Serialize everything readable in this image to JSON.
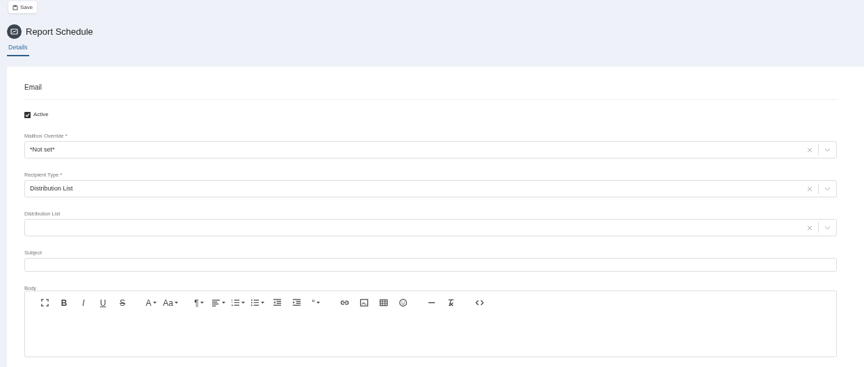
{
  "toolbar": {
    "save_button": "Save"
  },
  "header": {
    "title": "Report Schedule"
  },
  "tabs": [
    {
      "label": "Details",
      "selected": true
    }
  ],
  "form": {
    "section_title": "Email",
    "active": {
      "label": "Active",
      "checked": true
    },
    "fields": [
      {
        "kind": "select",
        "label": "Mailbox Override *",
        "value": "*Not set*"
      },
      {
        "kind": "select",
        "label": "Recipient Type *",
        "value": "Distribution List"
      },
      {
        "kind": "select",
        "label": "Distribution List"
      },
      {
        "kind": "text",
        "label": "Subject"
      },
      {
        "kind": "editor",
        "label": "Body"
      }
    ],
    "editor_toolbar": [
      [
        {
          "kind": "fullscreen"
        },
        {
          "kind": "bold",
          "glyph": "B"
        },
        {
          "kind": "italic",
          "glyph": "I"
        },
        {
          "kind": "underline",
          "glyph": "U"
        },
        {
          "kind": "strike",
          "glyph": "S"
        }
      ],
      [
        {
          "kind": "glyph",
          "glyph": "A",
          "caret": true
        },
        {
          "kind": "glyph",
          "glyph": "Aa",
          "caret": true
        }
      ],
      [
        {
          "kind": "glyph",
          "glyph": "¶",
          "caret": true
        },
        {
          "kind": "align",
          "caret": true
        },
        {
          "kind": "ordered-list",
          "caret": true
        },
        {
          "kind": "bullet-list",
          "caret": true
        },
        {
          "kind": "outdent"
        },
        {
          "kind": "indent"
        },
        {
          "kind": "glyph",
          "glyph": "“",
          "caret": true
        }
      ],
      [
        {
          "kind": "link"
        },
        {
          "kind": "image"
        },
        {
          "kind": "table"
        },
        {
          "kind": "emoji"
        }
      ],
      [
        {
          "kind": "rule"
        },
        {
          "kind": "clear-format"
        }
      ],
      [
        {
          "kind": "code"
        }
      ]
    ]
  }
}
